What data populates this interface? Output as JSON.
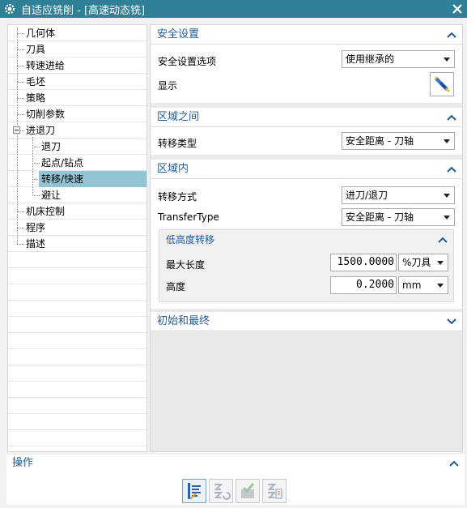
{
  "window": {
    "title": "自适应铣削 - [高速动态铣]",
    "accent": "#2f7f97",
    "close_icon": "close-icon",
    "app_icon": "gear-icon"
  },
  "tree": {
    "items": [
      {
        "label": "几何体",
        "level": 0
      },
      {
        "label": "刀具",
        "level": 0
      },
      {
        "label": "转速进给",
        "level": 0
      },
      {
        "label": "毛坯",
        "level": 0
      },
      {
        "label": "策略",
        "level": 0
      },
      {
        "label": "切削参数",
        "level": 0
      },
      {
        "label": "进退刀",
        "level": 0,
        "expanded": true
      },
      {
        "label": "退刀",
        "level": 1
      },
      {
        "label": "起点/钻点",
        "level": 1
      },
      {
        "label": "转移/快速",
        "level": 1,
        "selected": true
      },
      {
        "label": "避让",
        "level": 1
      },
      {
        "label": "机床控制",
        "level": 0
      },
      {
        "label": "程序",
        "level": 0
      },
      {
        "label": "描述",
        "level": 0
      }
    ],
    "selected_color": "#93c4d3"
  },
  "safety": {
    "header": "安全设置",
    "option_label": "安全设置选项",
    "option_value": "使用继承的",
    "display_label": "显示",
    "display_icon": "flashlight-icon"
  },
  "between": {
    "header": "区域之间",
    "type_label": "转移类型",
    "type_value": "安全距离 - 刀轴"
  },
  "within": {
    "header": "区域内",
    "method_label": "转移方式",
    "method_value": "进刀/退刀",
    "transfer_label": "TransferType",
    "transfer_value": "安全距离 - 刀轴",
    "low": {
      "header": "低高度转移",
      "maxlen_label": "最大长度",
      "maxlen_value": "1500.0000",
      "maxlen_unit": "%刀具",
      "height_label": "高度",
      "height_value": "0.2000",
      "height_unit": "mm"
    }
  },
  "initial": {
    "header": "初始和最终"
  },
  "footer": {
    "header": "操作",
    "tools": [
      "generate-icon",
      "replay-icon",
      "verify-icon",
      "list-icon"
    ]
  },
  "colors": {
    "header_text": "#1f5c9c"
  }
}
